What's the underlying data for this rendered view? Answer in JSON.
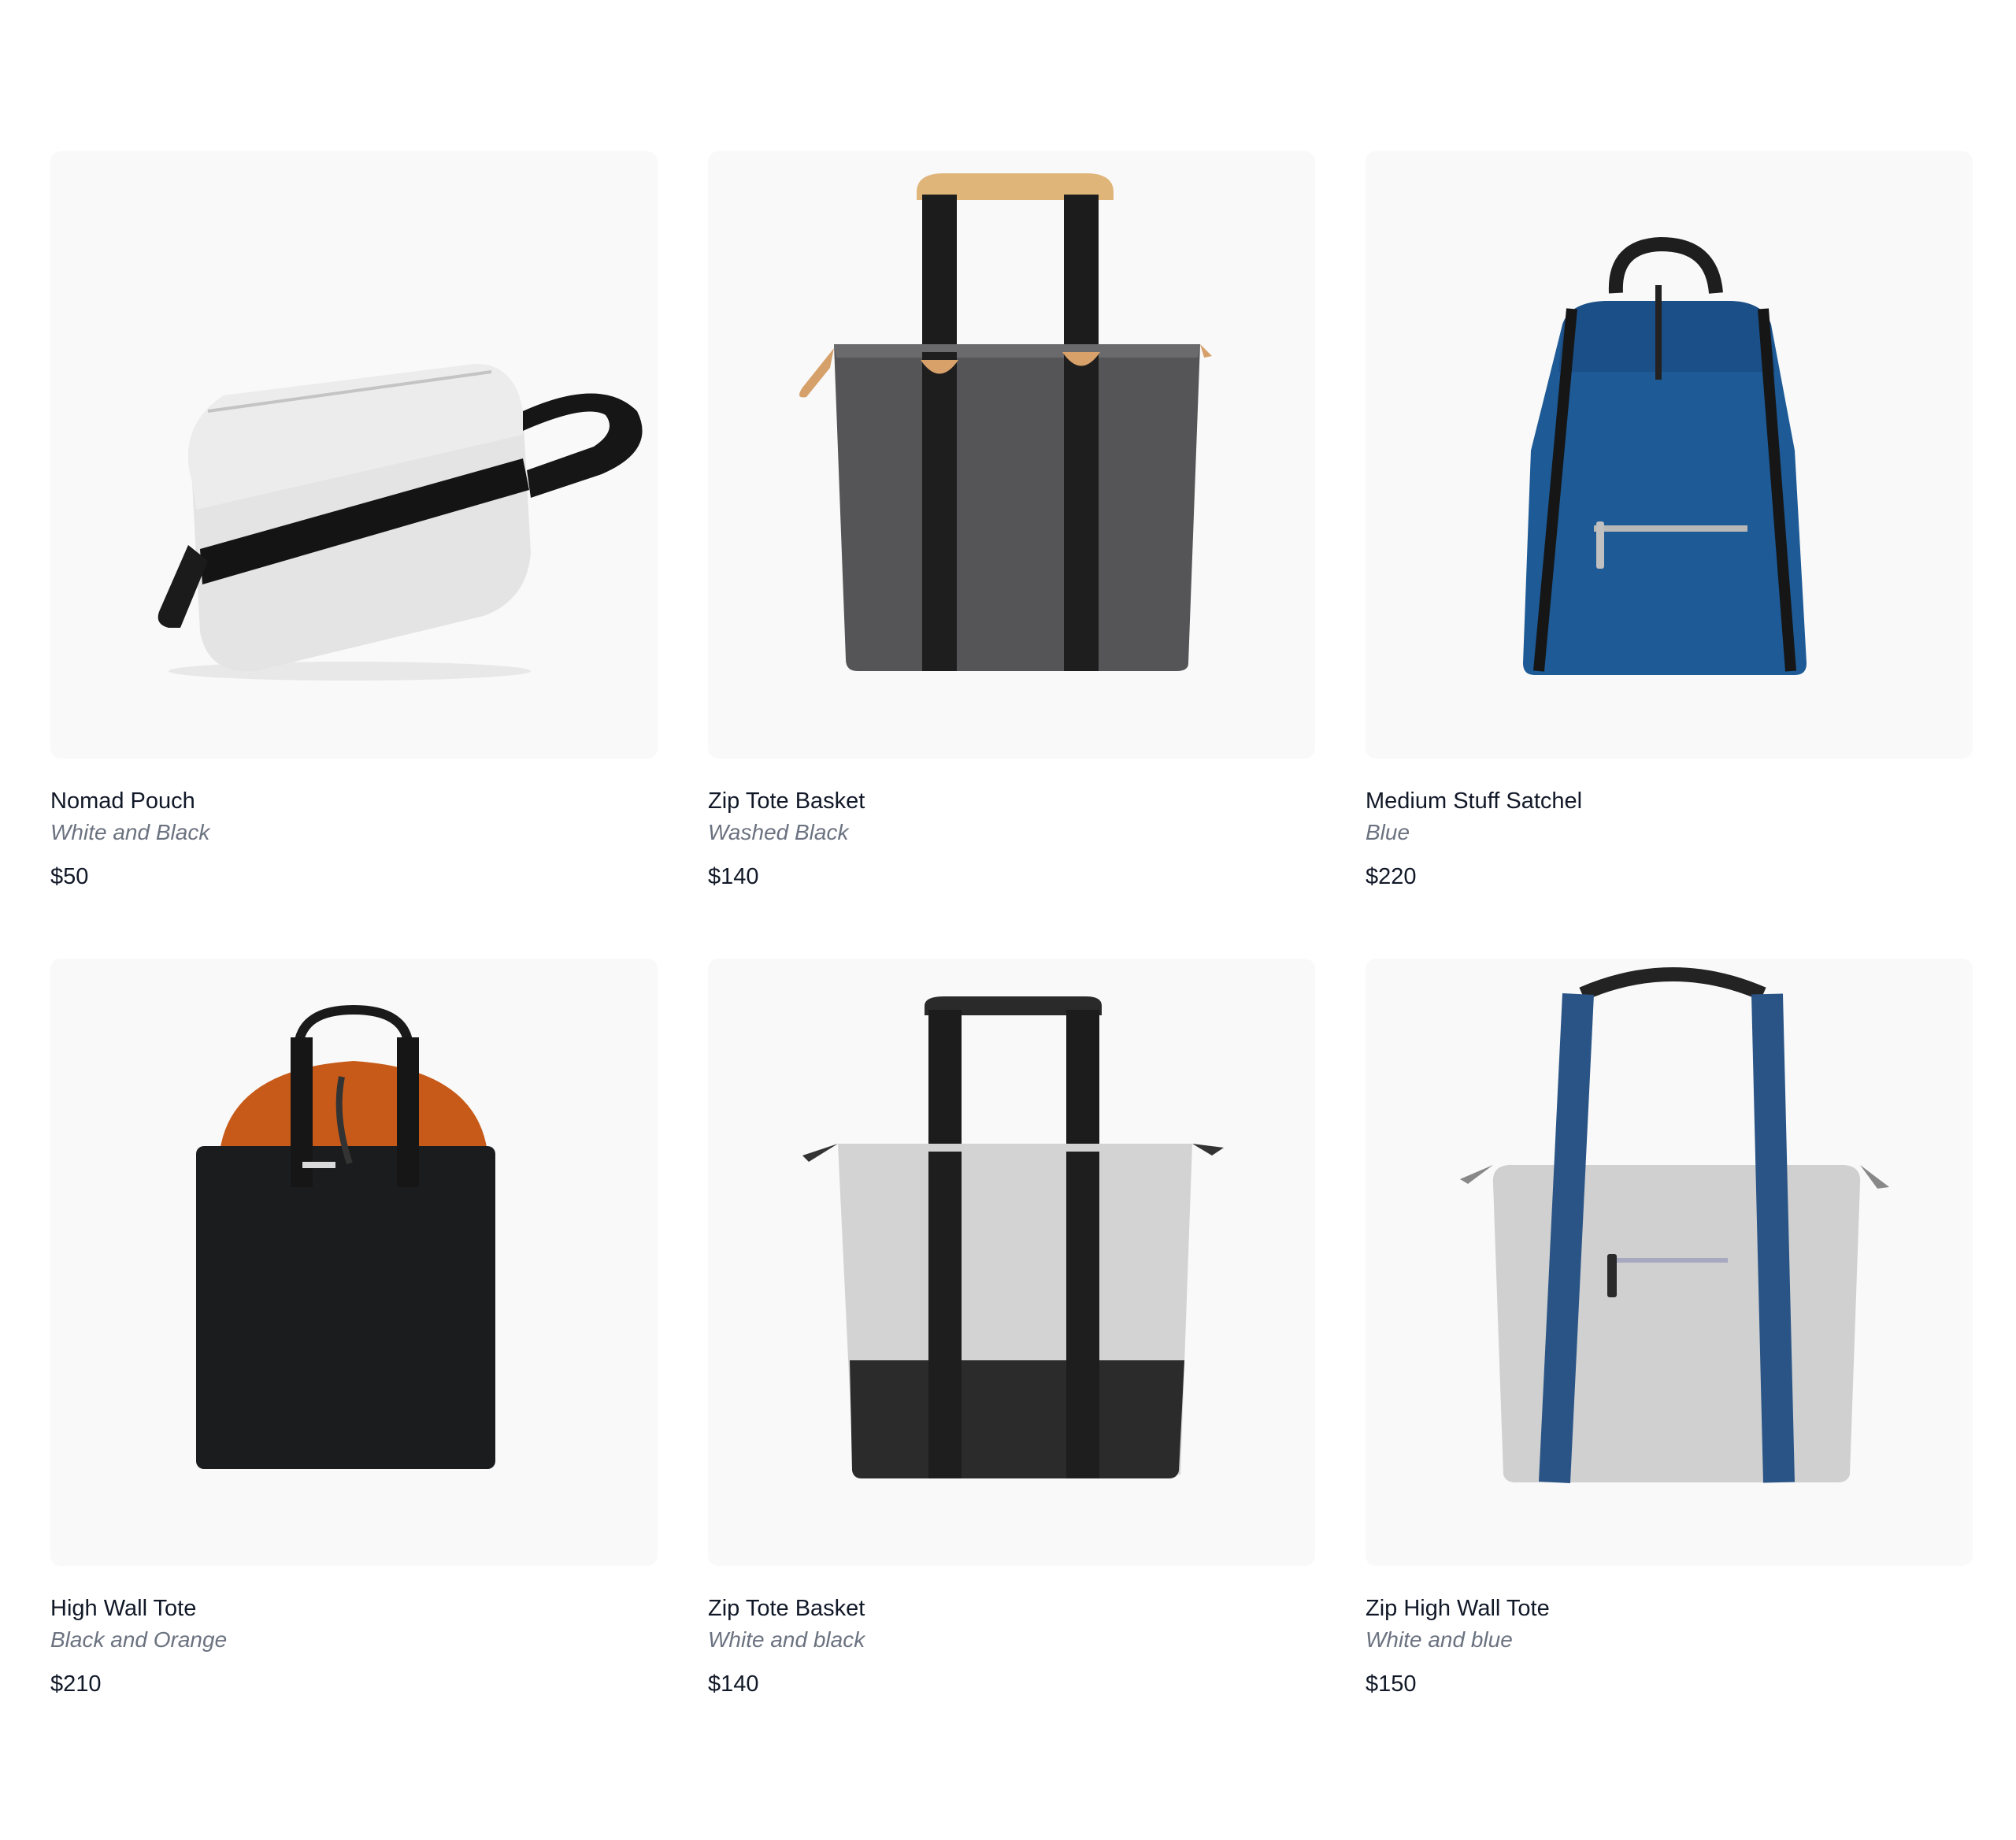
{
  "products": [
    {
      "name": "Nomad Pouch",
      "color": "White and Black",
      "price": "$50",
      "image": "bag-pouch-image"
    },
    {
      "name": "Zip Tote Basket",
      "color": "Washed Black",
      "price": "$140",
      "image": "bag-tote-grey-image"
    },
    {
      "name": "Medium Stuff Satchel",
      "color": "Blue",
      "price": "$220",
      "image": "bag-satchel-blue-image"
    },
    {
      "name": "High Wall Tote",
      "color": "Black and Orange",
      "price": "$210",
      "image": "bag-tote-black-orange-image"
    },
    {
      "name": "Zip Tote Basket",
      "color": "White and black",
      "price": "$140",
      "image": "bag-tote-white-black-image"
    },
    {
      "name": "Zip High Wall Tote",
      "color": "White and blue",
      "price": "$150",
      "image": "bag-tote-white-blue-image"
    }
  ]
}
